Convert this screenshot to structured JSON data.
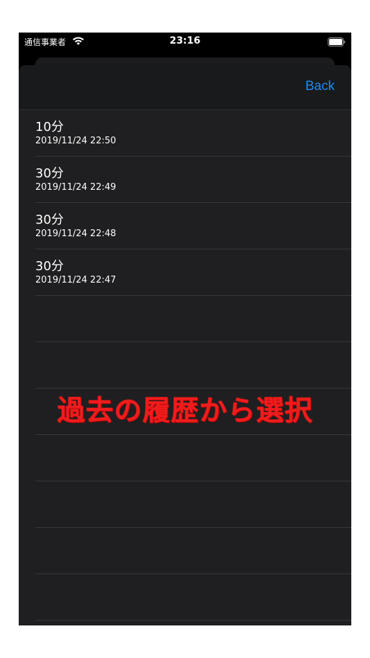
{
  "status_bar": {
    "carrier": "通信事業者",
    "time": "23:16"
  },
  "nav": {
    "back_label": "Back"
  },
  "history": [
    {
      "title": "10分",
      "date": "2019/11/24 22:50"
    },
    {
      "title": "30分",
      "date": "2019/11/24 22:49"
    },
    {
      "title": "30分",
      "date": "2019/11/24 22:48"
    },
    {
      "title": "30分",
      "date": "2019/11/24 22:47"
    }
  ],
  "caption": "過去の履歴から選択",
  "colors": {
    "accent": "#1e8cf5",
    "caption": "#ee1c1c",
    "background": "#1f1f21"
  }
}
